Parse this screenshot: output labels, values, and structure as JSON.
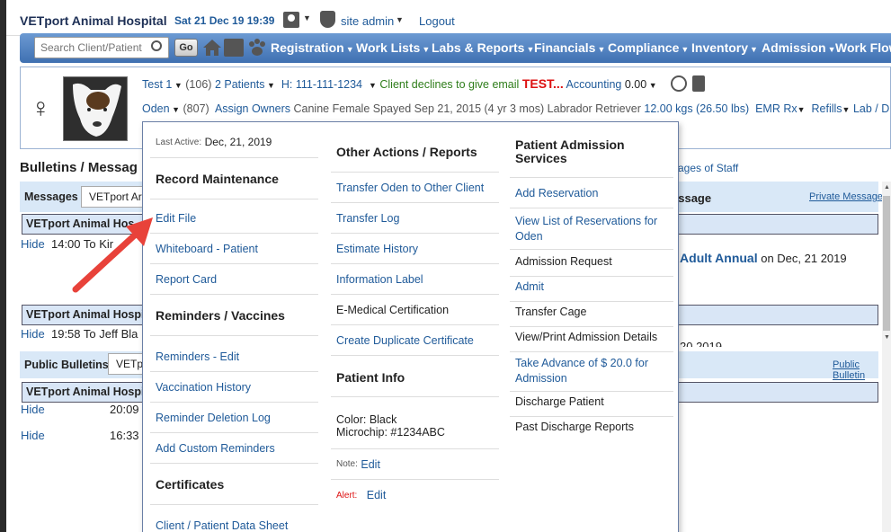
{
  "header": {
    "clinic_name": "VETport Animal Hospital",
    "datetime": "Sat 21 Dec 19 19:39",
    "user_role": "site admin",
    "logout": "Logout"
  },
  "nav": {
    "search_placeholder": "Search Client/Patient",
    "go": "Go",
    "items": [
      "Registration",
      "Work Lists",
      "Labs & Reports",
      "Financials",
      "Compliance",
      "Inventory",
      "Admission",
      "Work Flow"
    ]
  },
  "patient": {
    "client_name": "Test 1",
    "client_id": "(106)",
    "patients_label": "2  Patients",
    "phone": "H: 111-111-1234",
    "email_note": "Client declines to give email",
    "test_flag": "TEST...",
    "accounting_label": "Accounting",
    "accounting_value": "0.00",
    "pet_name": "Oden",
    "pet_id": "(807)",
    "assign_owners": "Assign Owners",
    "species": "Canine",
    "sex": "Female Spayed",
    "dob": "Sep 21, 2015 (4 yr 3 mos)",
    "breed": "Labrador Retriever",
    "weight": "12.00 kgs (26.50 lbs)",
    "emr": "EMR",
    "rx": "Rx",
    "refills": "Refills",
    "lab": "Lab / D"
  },
  "background": {
    "bulletins_heading": "Bulletins / Messag",
    "staff_link": "ssages of Staff",
    "messages_label": "Messages",
    "messages_select": "VETport Ar",
    "message_title": "essage",
    "private_message": "Private Message",
    "row1_text": "VETport Animal Hos",
    "hide1": "Hide",
    "msg1": "14:00  To Kir",
    "adult_link": "- Adult Annual",
    "adult_date": " on Dec, 21 2019",
    "row2_text": "VETport Animal Hospit",
    "hide2": "Hide",
    "msg2": "19:58  To Jeff Bla",
    "msg2_right": "20 2019",
    "public_label": "Public Bulletins",
    "public_select": "VETp",
    "public_link": "Public Bulletin",
    "row3_text": "VETport Animal Hospit",
    "hide3": "Hide",
    "time3": "20:09",
    "hide4": "Hide",
    "time4": "16:33"
  },
  "menu": {
    "last_active_label": "Last Active:",
    "last_active_value": "Dec, 21, 2019",
    "record_maintenance": "Record Maintenance",
    "edit_file": "Edit File",
    "whiteboard": "Whiteboard - Patient",
    "report_card": "Report Card",
    "reminders_vaccines": "Reminders / Vaccines",
    "reminders_edit": "Reminders - Edit",
    "vaccination_history": "Vaccination History",
    "reminder_deletion_log": "Reminder Deletion Log",
    "add_custom_reminders": "Add Custom Reminders",
    "certificates": "Certificates",
    "client_patient_sheet": "Client / Patient Data Sheet",
    "other_actions": "Other Actions / Reports",
    "transfer_oden": "Transfer Oden to Other Client",
    "transfer_log": "Transfer Log",
    "estimate_history": "Estimate History",
    "information_label": "Information Label",
    "e_medical": "E-Medical Certification",
    "create_duplicate": "Create Duplicate Certificate",
    "patient_info": "Patient Info",
    "color": "Color: Black",
    "microchip": "Microchip: #1234ABC",
    "note_label": "Note:",
    "note_edit": "Edit",
    "alert_label": "Alert:",
    "alert_edit": "Edit",
    "admission_services": "Patient Admission Services",
    "add_reservation": "Add Reservation",
    "view_reservations": "View List of Reservations for Oden",
    "admission_request": "Admission Request",
    "admit": "Admit",
    "transfer_cage": "Transfer Cage",
    "view_print_admission": "View/Print Admission Details",
    "take_advance": "Take Advance of $ 20.0 for Admission",
    "discharge_patient": "Discharge Patient",
    "past_discharge": "Past Discharge Reports"
  },
  "colors": {
    "nav_blue": "#3f70b1",
    "link_blue": "#1f5a99",
    "alert_red": "#d11111",
    "annotation_arrow": "#e8423a"
  }
}
